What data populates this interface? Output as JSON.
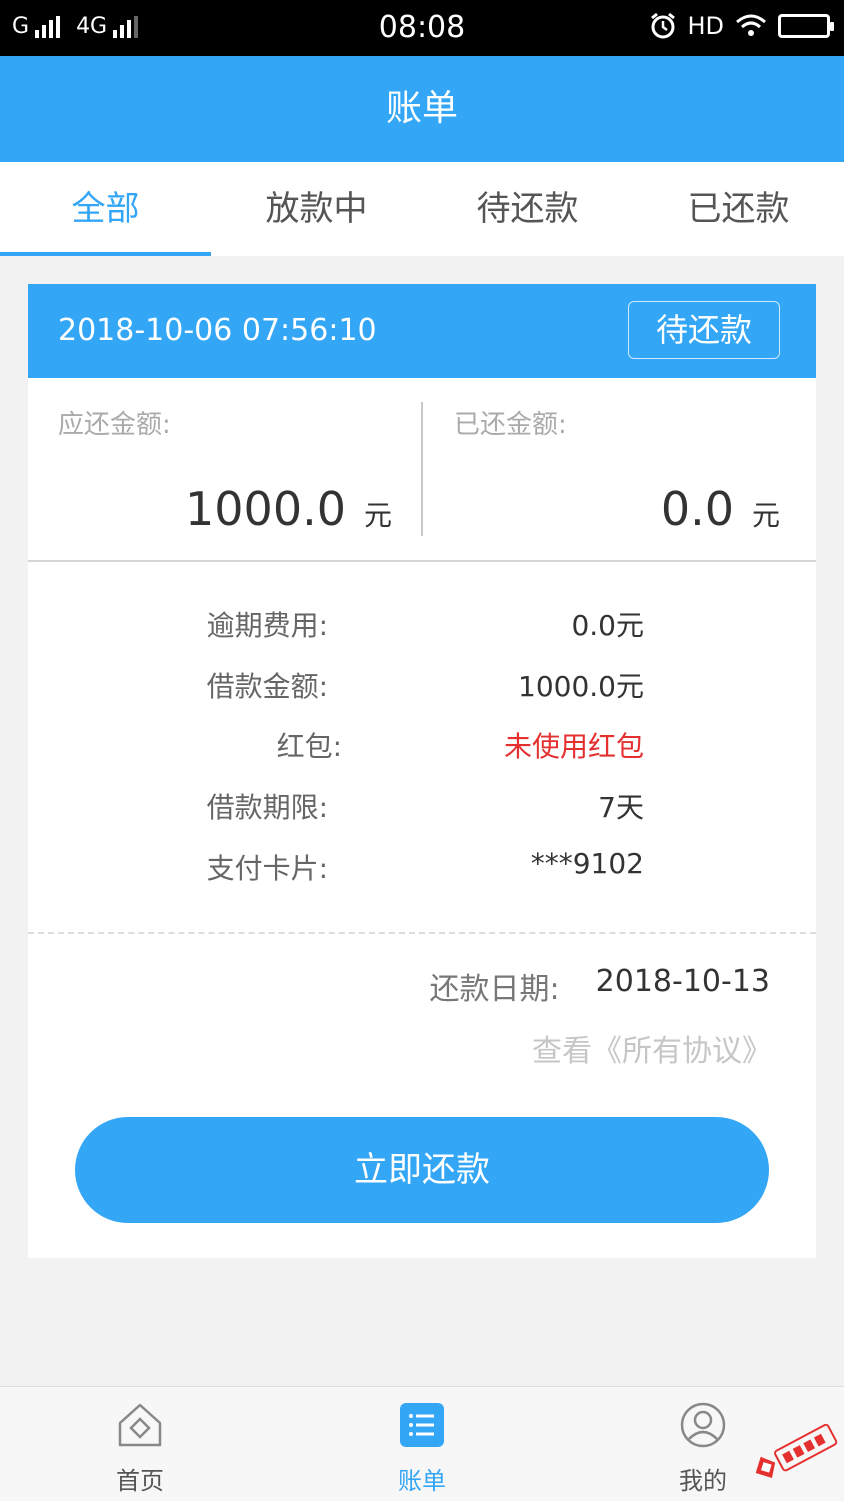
{
  "status_bar": {
    "signal_left": "G",
    "network": "4G",
    "time": "08:08",
    "hd": "HD"
  },
  "header": {
    "title": "账单"
  },
  "tabs": [
    {
      "label": "全部",
      "active": true
    },
    {
      "label": "放款中",
      "active": false
    },
    {
      "label": "待还款",
      "active": false
    },
    {
      "label": "已还款",
      "active": false
    }
  ],
  "bill": {
    "datetime": "2018-10-06 07:56:10",
    "status": "待还款",
    "due_amount_label": "应还金额:",
    "due_amount": "1000.0",
    "paid_amount_label": "已还金额:",
    "paid_amount": "0.0",
    "unit": "元",
    "details": [
      {
        "label": "逾期费用:",
        "value": "0.0元"
      },
      {
        "label": "借款金额:",
        "value": "1000.0元"
      },
      {
        "label": "红包:",
        "value": "未使用红包"
      },
      {
        "label": "借款期限:",
        "value": "7天"
      },
      {
        "label": "支付卡片:",
        "value": "***9102"
      }
    ],
    "repay_date_label": "还款日期:",
    "repay_date": "2018-10-13",
    "agreement_link": "查看《所有协议》",
    "pay_button": "立即还款"
  },
  "bottom_nav": [
    {
      "label": "首页",
      "icon": "home-icon",
      "active": false
    },
    {
      "label": "账单",
      "icon": "bill-list-icon",
      "active": true
    },
    {
      "label": "我的",
      "icon": "user-icon",
      "active": false
    }
  ],
  "colors": {
    "accent": "#33a6f6",
    "red": "#e53030"
  }
}
